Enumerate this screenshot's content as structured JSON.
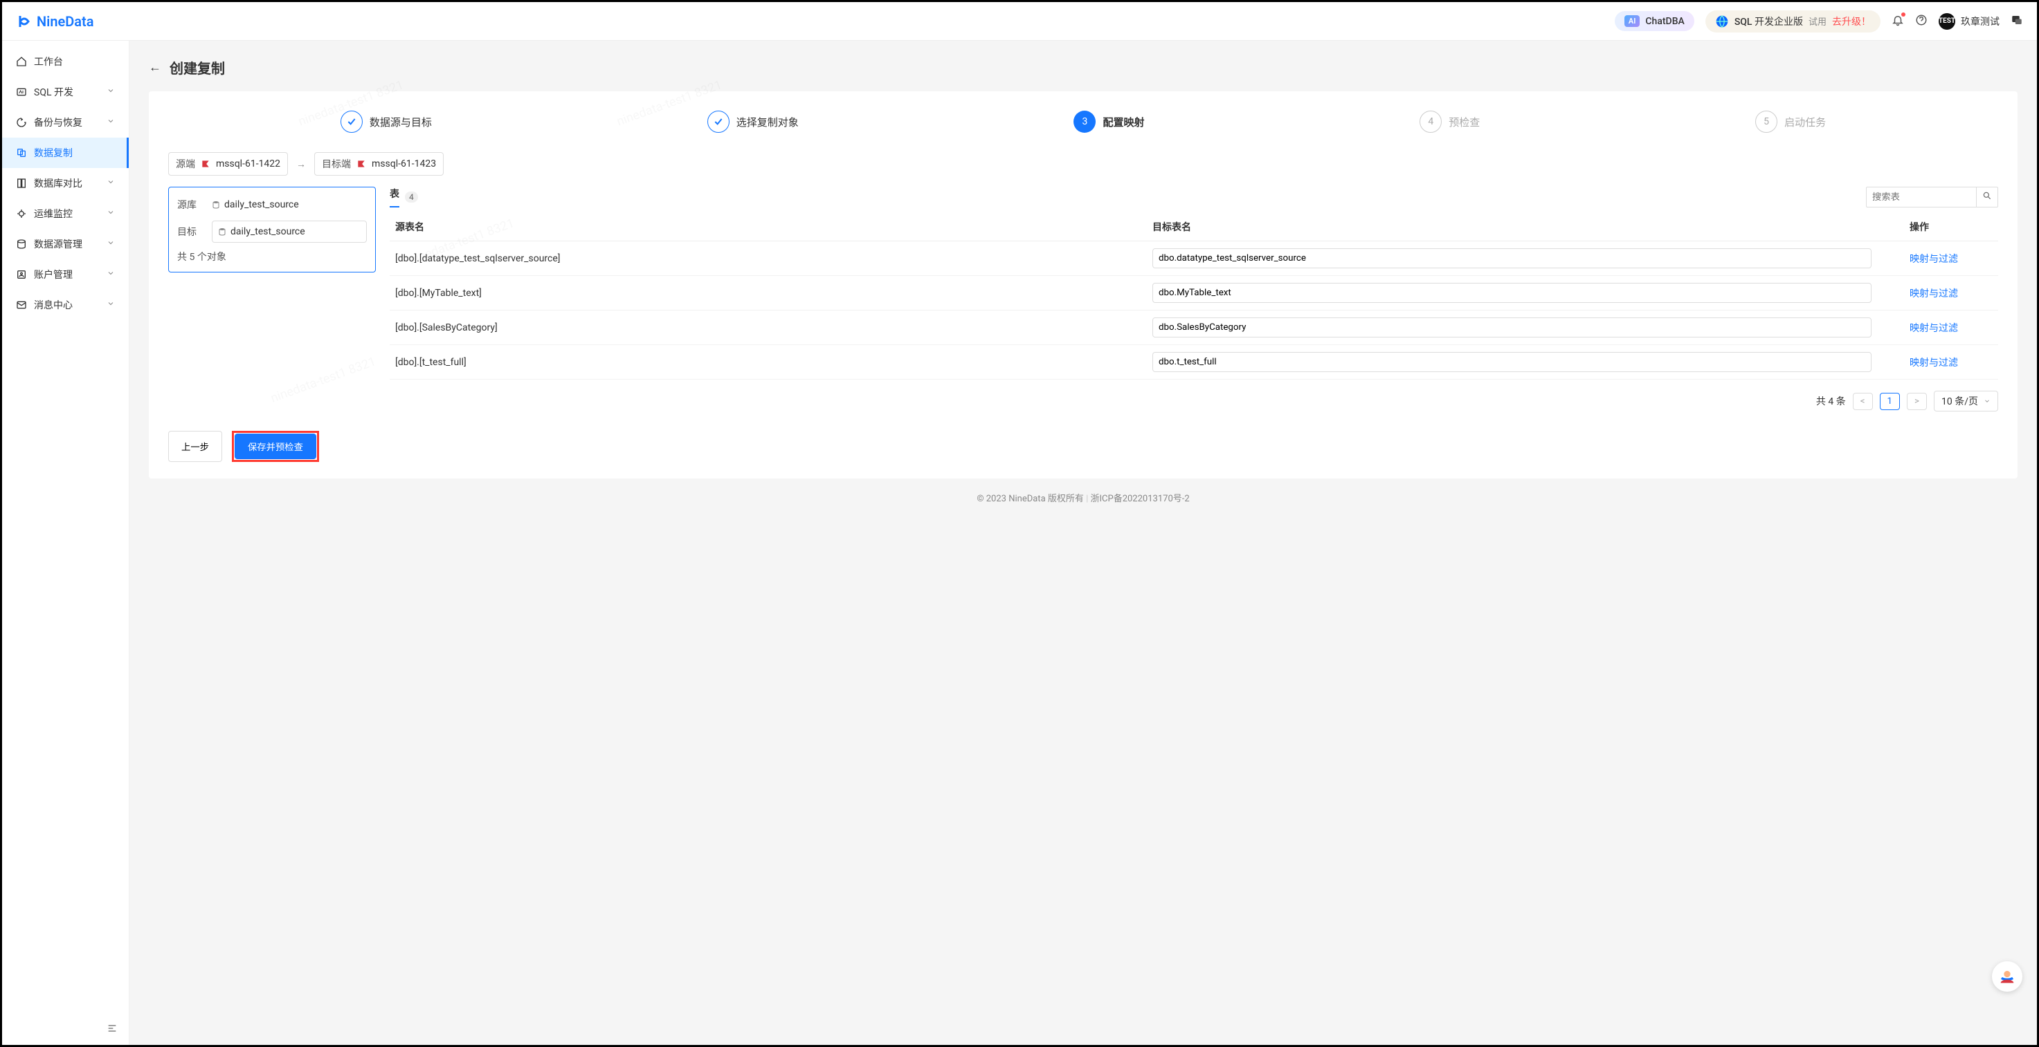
{
  "header": {
    "brand": "NineData",
    "chatdba": "ChatDBA",
    "sql_edition": "SQL 开发企业版",
    "try_label": "试用",
    "upgrade_label": "去升级！",
    "username": "玖章测试",
    "avatar_text": "TEST"
  },
  "sidebar": {
    "items": [
      {
        "label": "工作台",
        "icon": "home",
        "expandable": false
      },
      {
        "label": "SQL 开发",
        "icon": "sql",
        "expandable": true
      },
      {
        "label": "备份与恢复",
        "icon": "backup",
        "expandable": true
      },
      {
        "label": "数据复制",
        "icon": "copy",
        "expandable": false,
        "active": true
      },
      {
        "label": "数据库对比",
        "icon": "compare",
        "expandable": true
      },
      {
        "label": "运维监控",
        "icon": "monitor",
        "expandable": true
      },
      {
        "label": "数据源管理",
        "icon": "datasource",
        "expandable": true
      },
      {
        "label": "账户管理",
        "icon": "account",
        "expandable": true
      },
      {
        "label": "消息中心",
        "icon": "message",
        "expandable": true
      }
    ]
  },
  "page": {
    "title": "创建复制",
    "steps": [
      {
        "label": "数据源与目标",
        "state": "done"
      },
      {
        "label": "选择复制对象",
        "state": "done"
      },
      {
        "label": "配置映射",
        "state": "active",
        "num": "3"
      },
      {
        "label": "预检查",
        "state": "pending",
        "num": "4"
      },
      {
        "label": "启动任务",
        "state": "pending",
        "num": "5"
      }
    ],
    "breadcrumb": {
      "source_label": "源端",
      "source_value": "mssql-61-1422",
      "arrow": "→",
      "target_label": "目标端",
      "target_value": "mssql-61-1423"
    },
    "db_panel": {
      "source_label": "源库",
      "source_value": "daily_test_source",
      "target_label": "目标",
      "target_value": "daily_test_source",
      "count_text": "共 5 个对象"
    },
    "table": {
      "tab_label": "表",
      "tab_count": "4",
      "search_placeholder": "搜索表",
      "columns": {
        "src": "源表名",
        "dst": "目标表名",
        "op": "操作"
      },
      "rows": [
        {
          "src": "[dbo].[datatype_test_sqlserver_source]",
          "dst": "dbo.datatype_test_sqlserver_source"
        },
        {
          "src": "[dbo].[MyTable_text]",
          "dst": "dbo.MyTable_text"
        },
        {
          "src": "[dbo].[SalesByCategory]",
          "dst": "dbo.SalesByCategory"
        },
        {
          "src": "[dbo].[t_test_full]",
          "dst": "dbo.t_test_full"
        }
      ],
      "action_label": "映射与过滤",
      "total_text": "共 4 条",
      "page_current": "1",
      "page_size": "10 条/页"
    },
    "buttons": {
      "prev": "上一步",
      "save": "保存并预检查"
    },
    "copyright": "© 2023 NineData 版权所有",
    "icp": "浙ICP备2022013170号-2"
  },
  "watermark": "ninedata-test1 8321"
}
